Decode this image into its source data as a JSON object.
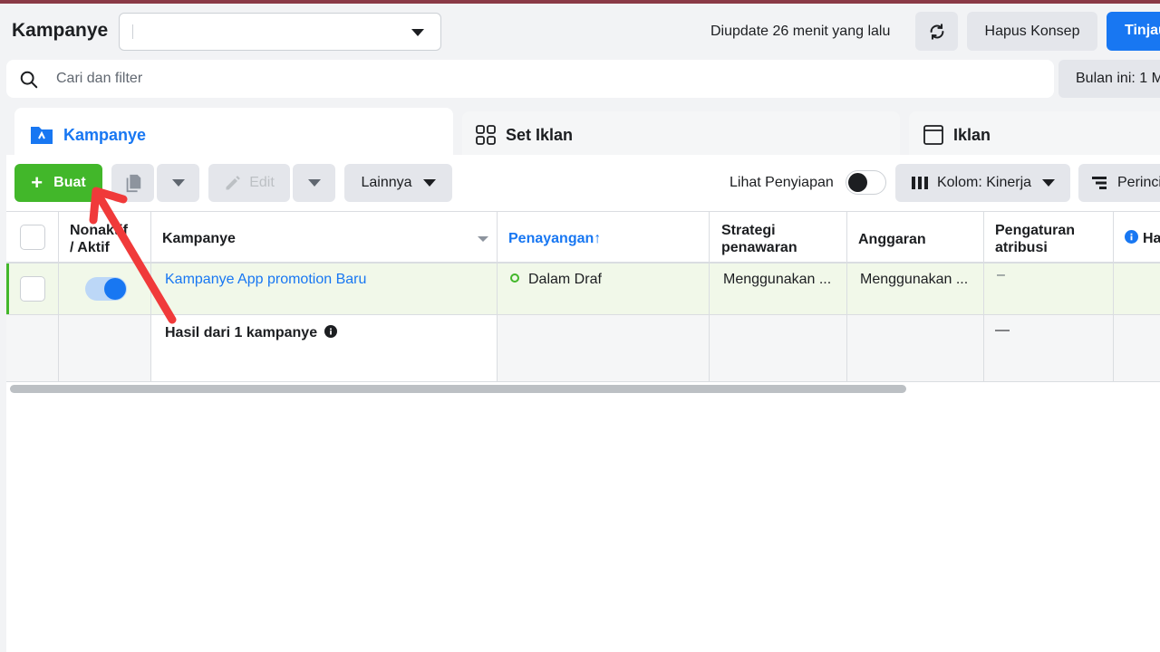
{
  "header": {
    "title": "Kampanye",
    "account_selector_value": "",
    "updated_text": "Diupdate 26 menit yang lalu",
    "discard_label": "Hapus Konsep",
    "review_label": "Tinjau"
  },
  "search": {
    "placeholder": "Cari dan filter",
    "date_range_label": "Bulan ini: 1 M"
  },
  "tabs": [
    {
      "label": "Kampanye",
      "active": true
    },
    {
      "label": "Set Iklan",
      "active": false
    },
    {
      "label": "Iklan",
      "active": false
    }
  ],
  "toolbar": {
    "create_label": "Buat",
    "edit_label": "Edit",
    "more_label": "Lainnya",
    "preview_label": "Lihat Penyiapan",
    "columns_label": "Kolom: Kinerja",
    "breakdown_label": "Perinci"
  },
  "table": {
    "headers": {
      "toggle_line1": "Nonaktif",
      "toggle_line2": "/ Aktif",
      "campaign": "Kampanye",
      "delivery": "Penayangan",
      "delivery_sort": "↑",
      "bid_line1": "Strategi",
      "bid_line2": "penawaran",
      "budget": "Anggaran",
      "attribution_line1": "Pengaturan",
      "attribution_line2": "atribusi",
      "results": "Hasil"
    },
    "rows": [
      {
        "campaign": "Kampanye App promotion Baru",
        "delivery": "Dalam Draf",
        "bid_strategy": "Menggunakan ...",
        "budget": "Menggunakan ...",
        "attribution": "–",
        "active": true
      }
    ],
    "summary": {
      "label": "Hasil dari 1 kampanye",
      "attribution": "—"
    }
  },
  "colors": {
    "accent": "#1877f2",
    "create": "#42b72a",
    "annotation_arrow": "#f03a3a"
  }
}
